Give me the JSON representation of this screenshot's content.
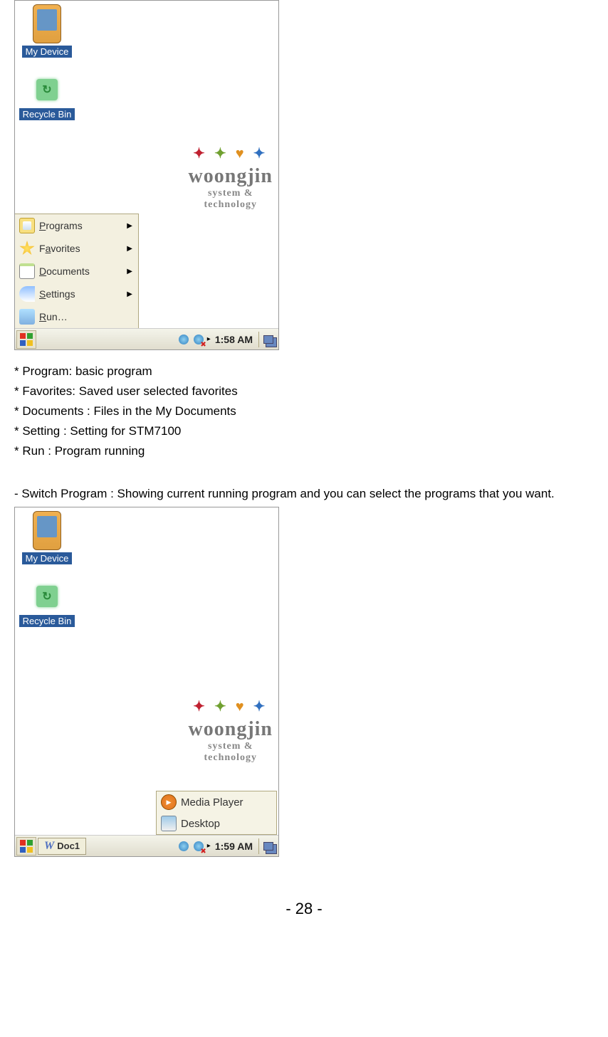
{
  "screenshot1": {
    "desktop": {
      "my_device": "My Device",
      "recycle_bin": "Recycle Bin"
    },
    "logo": {
      "brand": "woongjin",
      "tagline_1": "system &",
      "tagline_2": "technology"
    },
    "start_menu": {
      "programs": "Programs",
      "programs_u": "P",
      "favorites": "Favorites",
      "favorites_u": "a",
      "documents": "Documents",
      "documents_u": "D",
      "settings": "Settings",
      "settings_u": "S",
      "run": "Run...",
      "run_u": "R"
    },
    "taskbar": {
      "clock": "1:58 AM",
      "sep": "▸"
    }
  },
  "notes": {
    "program": "* Program: basic program",
    "favorites": "* Favorites: Saved user selected favorites",
    "documents": "* Documents : Files in the My Documents",
    "setting": "* Setting : Setting for STM7100",
    "run": "* Run : Program running",
    "switch": "- Switch Program : Showing current running program and you can select the programs that you want."
  },
  "screenshot2": {
    "desktop": {
      "my_device": "My Device",
      "recycle_bin": "Recycle Bin"
    },
    "logo": {
      "brand": "woongjin",
      "tagline_1": "system &",
      "tagline_2": "technology"
    },
    "switch_popup": {
      "media_player": "Media Player",
      "desktop": "Desktop"
    },
    "taskbar": {
      "task_doc": "Doc1",
      "clock": "1:59 AM",
      "sep": "▸"
    }
  },
  "footer": {
    "page_no": "- 28 -"
  }
}
